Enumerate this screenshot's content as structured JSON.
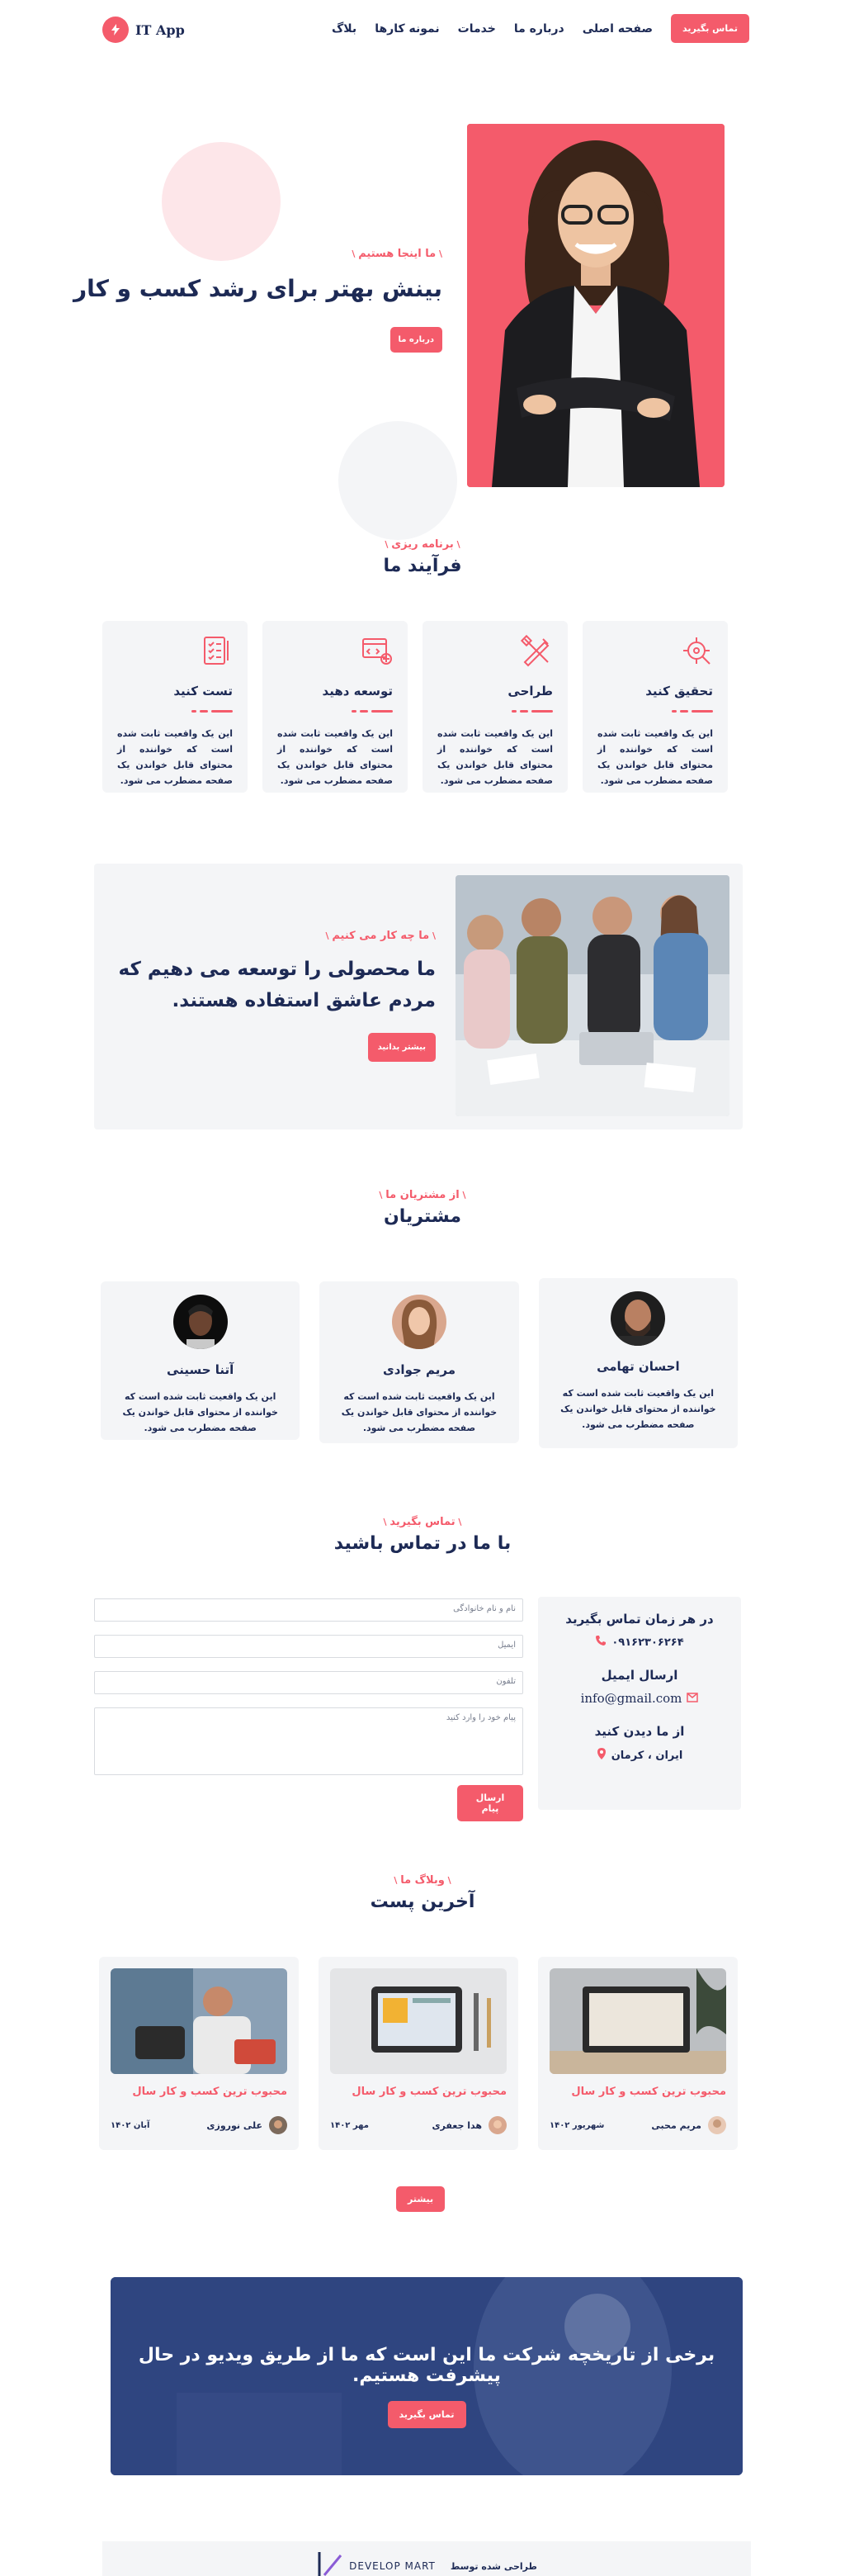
{
  "header": {
    "logo_text": "IT App",
    "nav": [
      "صفحه اصلی",
      "درباره ما",
      "خدمات",
      "نمونه کارها",
      "بلاگ"
    ],
    "cta": "تماس بگیرید"
  },
  "hero": {
    "eyebrow": "ما اینجا هستیم",
    "title": "بینش بهتر برای رشد کسب و کار",
    "button": "درباره ما"
  },
  "process": {
    "eyebrow": "برنامه ریزی",
    "title": "فرآیند ما",
    "cards": [
      {
        "title": "تحقیق کنید",
        "icon": "research-icon",
        "text": "این یک واقعیت ثابت شده است که خواننده از محتوای قابل خواندن یک صفحه مضطرب می شود."
      },
      {
        "title": "طراحی",
        "icon": "design-tools-icon",
        "text": "این یک واقعیت ثابت شده است که خواننده از محتوای قابل خواندن یک صفحه مضطرب می شود."
      },
      {
        "title": "توسعه دهید",
        "icon": "develop-icon",
        "text": "این یک واقعیت ثابت شده است که خواننده از محتوای قابل خواندن یک صفحه مضطرب می شود."
      },
      {
        "title": "تست کنید",
        "icon": "checklist-icon",
        "text": "این یک واقعیت ثابت شده است که خواننده از محتوای قابل خواندن یک صفحه مضطرب می شود."
      }
    ]
  },
  "what_we_do": {
    "eyebrow": "ما چه کار می کنیم",
    "title": "ما محصولی را توسعه می دهیم که مردم عاشق استفاده هستند.",
    "button": "بیشتر بدانید"
  },
  "customers": {
    "eyebrow": "از مشتریان ما",
    "title": "مشتریان",
    "items": [
      {
        "name": "احسان تهامی",
        "text": "این یک واقعیت ثابت شده است که خواننده از محتوای قابل خواندن یک صفحه مضطرب می شود."
      },
      {
        "name": "مریم جوادی",
        "text": "این یک واقعیت ثابت شده است که خواننده از محتوای قابل خواندن یک صفحه مضطرب می شود."
      },
      {
        "name": "آتنا حسینی",
        "text": "این یک واقعیت ثابت شده است که خواننده از محتوای قابل خواندن یک صفحه مضطرب می شود."
      }
    ]
  },
  "contact": {
    "eyebrow": "تماس بگیرید",
    "title": "با ما در تماس باشید",
    "call_title": "در هر زمان تماس بگیرید",
    "phone": "۰۹۱۶۲۳۰۶۲۶۴",
    "email_title": "ارسال ایمیل",
    "email": "info@gmail.com",
    "visit_title": "از ما دیدن کنید",
    "address": "ایران ، کرمان",
    "form": {
      "name_placeholder": "نام و نام خانوادگی",
      "email_placeholder": "ایمیل",
      "phone_placeholder": "تلفون",
      "message_placeholder": "پیام خود را وارد کنید",
      "submit": "ارسال پیام"
    }
  },
  "blog": {
    "eyebrow": "وبلاگ ما",
    "title": "آخرین پست",
    "posts": [
      {
        "title": "محبوب ترین کسب و کار سال",
        "author": "مریم محبی",
        "date": "شهریور ۱۴۰۲"
      },
      {
        "title": "محبوب ترین کسب و کار سال",
        "author": "هدا جعفری",
        "date": "مهر ۱۴۰۲"
      },
      {
        "title": "محبوب ترین کسب و کار سال",
        "author": "علی نوروزی",
        "date": "آبان ۱۴۰۲"
      }
    ],
    "more": "بیشتر"
  },
  "video": {
    "title": "برخی از تاریخچه شرکت ما این است که ما از طریق ویدیو در حال پیشرفت هستیم.",
    "button": "تماس بگیرید"
  },
  "footer": {
    "label": "طراحی شده توسط",
    "brand": "DEVELOP MART"
  },
  "colors": {
    "accent": "#f45b6b",
    "navy": "#1d2a55",
    "panel": "#f4f5f7"
  }
}
